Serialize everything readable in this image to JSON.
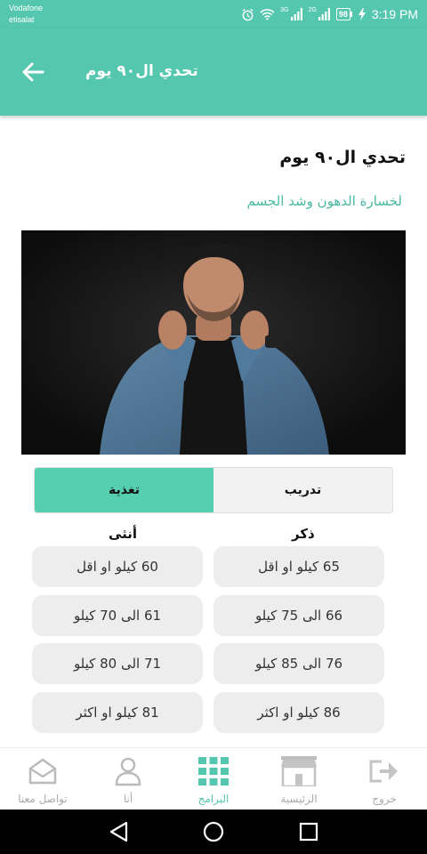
{
  "status_bar": {
    "carrier_1": "Vodafone",
    "carrier_2": "etisalat",
    "signal_1_label": "3G",
    "signal_2_label": "2G",
    "battery": "98",
    "time": "3:19 PM"
  },
  "app_bar": {
    "title": "تحدي ال٩٠ يوم"
  },
  "content": {
    "title": "تحدي ال٩٠ يوم",
    "subtitle": "لخسارة الدهون وشد الجسم"
  },
  "tabs": {
    "training": "تدريب",
    "nutrition": "تغذية",
    "active": "nutrition"
  },
  "columns": {
    "male": "ذكر",
    "female": "أنثى"
  },
  "female_options": [
    "60 كيلو او اقل",
    "61 الى 70 كيلو",
    "71 الى 80 كيلو",
    "81 كيلو او اكثر"
  ],
  "male_options": [
    "65 كيلو او اقل",
    "66 الى 75 كيلو",
    "76 الى 85 كيلو",
    "86 كيلو او اكثر"
  ],
  "bottom_nav": {
    "contact": "تواصل معنا",
    "me": "أنا",
    "programs": "البرامج",
    "home": "الرئيسية",
    "logout": "خروج",
    "active": "programs"
  },
  "colors": {
    "primary": "#56c7af",
    "tab_active": "#56cfb0",
    "subtitle": "#49b9a2"
  }
}
